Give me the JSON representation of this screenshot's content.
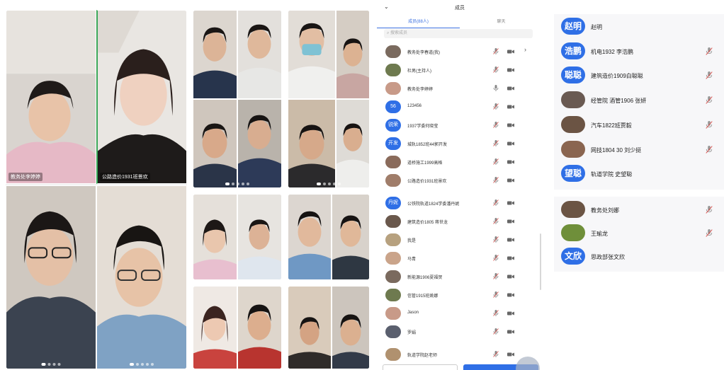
{
  "left_grid": {
    "tiles": [
      {
        "label": "教务处李婷婷"
      },
      {
        "label": "公路造价1931班景欢"
      },
      {
        "label": ""
      },
      {
        "label": ""
      }
    ]
  },
  "phone_list": {
    "header_title": "成员",
    "tabs": [
      {
        "label": "成员(88人)"
      },
      {
        "label": "聊天"
      }
    ],
    "search_placeholder": "搜索成员",
    "members": [
      {
        "name": "教务处李春道(我)",
        "avatar_text": "",
        "chev": true
      },
      {
        "name": "杜男(主持人)",
        "avatar_text": ""
      },
      {
        "name": "教务处李婷婷",
        "avatar_text": ""
      },
      {
        "name": "123456",
        "avatar_text": "56"
      },
      {
        "name": "1937学委何晓莹",
        "avatar_text": "锐荣"
      },
      {
        "name": "城轨1852班44郭开发",
        "avatar_text": "开发"
      },
      {
        "name": "道桥施工1999高格",
        "avatar_text": ""
      },
      {
        "name": "公路造价1931班景欢",
        "avatar_text": ""
      },
      {
        "name": "公铁院轨道1824学委潘丹妮",
        "avatar_text": "丹妮"
      },
      {
        "name": "建筑造价1805 蒋世龙",
        "avatar_text": ""
      },
      {
        "name": "我是",
        "avatar_text": ""
      },
      {
        "name": "马青",
        "avatar_text": ""
      },
      {
        "name": "新能源1906夏福贺",
        "avatar_text": ""
      },
      {
        "name": "信管1915班姚娜",
        "avatar_text": ""
      },
      {
        "name": "Jason",
        "avatar_text": ""
      },
      {
        "name": "罗娟",
        "avatar_text": ""
      },
      {
        "name": "轨道学院赵老师",
        "avatar_text": ""
      }
    ]
  },
  "right_list": {
    "members": [
      {
        "name": "赵明",
        "avatar_text": "赵明"
      },
      {
        "name": "机电1932 李浩鹏",
        "avatar_text": "浩鹏"
      },
      {
        "name": "建筑造价1909白聪聪",
        "avatar_text": "聪聪"
      },
      {
        "name": "经管院 酒管1906 张妍",
        "avatar_text": ""
      },
      {
        "name": "汽车1822班贾毅",
        "avatar_text": ""
      },
      {
        "name": "网技1804 30 刘少挺",
        "avatar_text": ""
      },
      {
        "name": "轨道学院 史望聪",
        "avatar_text": "望聪"
      }
    ],
    "members2": [
      {
        "name": "教务处刘娜",
        "avatar_text": ""
      },
      {
        "name": "王瑜龙",
        "avatar_text": ""
      },
      {
        "name": "思政部张文欣",
        "avatar_text": "文欣"
      }
    ]
  },
  "colors": {
    "accent": "#2f6fe6",
    "mic_muted": "#d9534f",
    "mic_active": "#3aa657"
  }
}
